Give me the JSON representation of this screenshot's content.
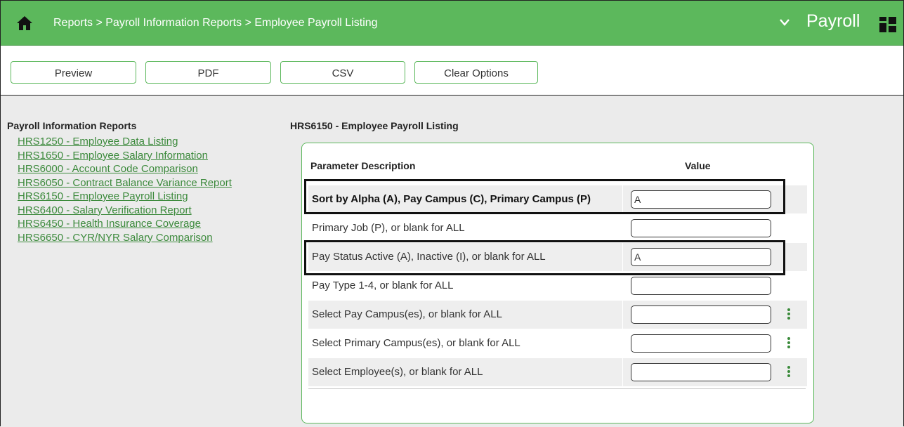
{
  "header": {
    "breadcrumb": "Reports > Payroll Information Reports > Employee Payroll Listing",
    "module": "Payroll",
    "bg_color": "#5cb85c"
  },
  "toolbar": {
    "preview_label": "Preview",
    "pdf_label": "PDF",
    "csv_label": "CSV",
    "clear_label": "Clear Options"
  },
  "nav": {
    "title": "Payroll Information Reports",
    "links": [
      "HRS1250 - Employee Data Listing",
      "HRS1650 - Employee Salary Information",
      "HRS6000 - Account Code Comparison",
      "HRS6050 - Contract Balance Variance Report",
      "HRS6150 - Employee Payroll Listing",
      "HRS6400 - Salary Verification Report",
      "HRS6450 - Health Insurance Coverage",
      "HRS6650 - CYR/NYR Salary Comparison"
    ]
  },
  "report": {
    "title": "HRS6150 - Employee Payroll Listing",
    "col_description": "Parameter Description",
    "col_value": "Value",
    "params": [
      {
        "label": "Sort by Alpha (A), Pay Campus (C), Primary Campus (P)",
        "value": "A"
      },
      {
        "label": "Primary Job (P), or blank for ALL",
        "value": ""
      },
      {
        "label": "Pay Status Active (A), Inactive (I), or blank for ALL",
        "value": "A"
      },
      {
        "label": "Pay Type 1-4, or blank for ALL",
        "value": ""
      },
      {
        "label": "Select Pay Campus(es), or blank for ALL",
        "value": ""
      },
      {
        "label": "Select Primary Campus(es), or blank for ALL",
        "value": ""
      },
      {
        "label": "Select Employee(s), or blank for ALL",
        "value": ""
      }
    ]
  },
  "icons": [
    "home-icon",
    "chevron-down-icon",
    "app-grid-icon",
    "kebab-menu-icon"
  ]
}
